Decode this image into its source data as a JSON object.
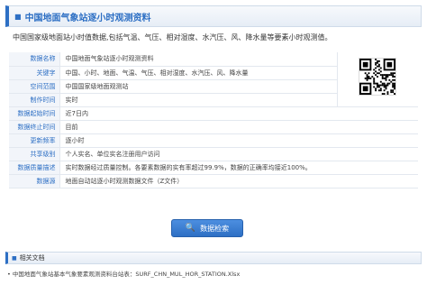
{
  "header": {
    "title": "中国地面气象站逐小时观测资料",
    "icon": "square-bullet-icon"
  },
  "intro": "中国国家级地面站小时值数据,包括气温、气压、相对湿度、水汽压、风、降水量等要素小时观测值。",
  "info_rows": [
    {
      "label": "数据名称",
      "value": "中国地面气象站逐小时观测资料"
    },
    {
      "label": "关键字",
      "value": "中国、小时、地面、气温、气压、相对湿度、水汽压、风、降水量"
    },
    {
      "label": "空间范围",
      "value": "中国国家级地面观测站"
    },
    {
      "label": "制作时间",
      "value": "实时"
    },
    {
      "label": "数据起始时间",
      "value": "近7日内"
    },
    {
      "label": "数据终止时间",
      "value": "目前"
    },
    {
      "label": "更新频率",
      "value": "逐小时"
    },
    {
      "label": "共享级别",
      "value": "个人实名、单位实名注册用户访问"
    },
    {
      "label": "数据质量描述",
      "value": "实时数据经过质量控制。各要素数据的实有率超过99.9%，数据的正确率均接近100%。"
    },
    {
      "label": "数据源",
      "value": "地面自动站逐小时观测数据文件（Z文件）"
    }
  ],
  "search_button": {
    "label": "数据检索",
    "icon": "search-icon"
  },
  "docs": {
    "header": "相关文档",
    "items": [
      "• 中国地面气象站基本气象要素观测资料台站表：SURF_CHN_MUL_HOR_STATION.Xlsx"
    ]
  },
  "colors": {
    "accent": "#2d6fc4",
    "label_bg": "#f2f5fa"
  }
}
